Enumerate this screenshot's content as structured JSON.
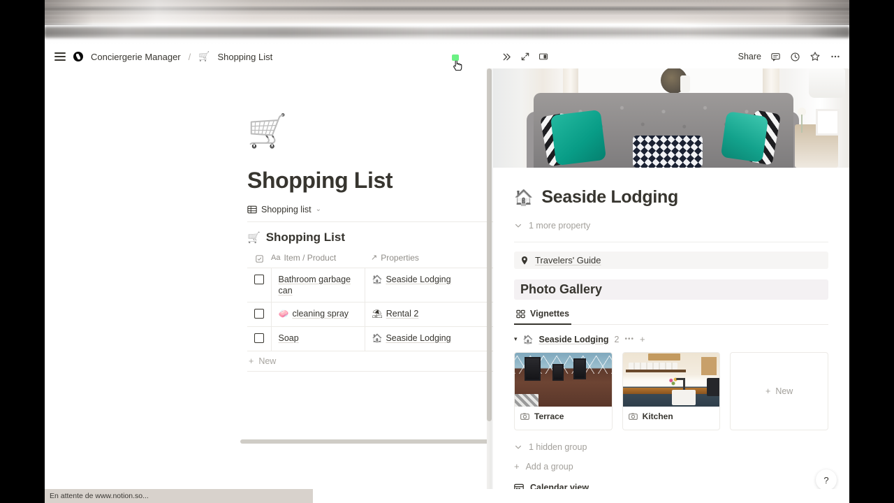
{
  "browser": {
    "status_text": "En attente de www.notion.so..."
  },
  "topbar": {
    "menu_icon": "hamburger-icon",
    "workspace_icon": "notion-logo-icon",
    "breadcrumb": [
      {
        "label": "Conciergerie Manager",
        "emoji": ""
      },
      {
        "label": "Shopping List",
        "emoji": "🛒"
      }
    ],
    "separator": "/"
  },
  "left_page": {
    "page_emoji": "🛒",
    "title": "Shopping List",
    "database_selector": {
      "label": "Shopping list",
      "chevron": "⌄",
      "icon": "table-icon"
    },
    "table": {
      "emoji": "🛒",
      "name": "Shopping List",
      "columns": [
        {
          "label": "",
          "icon": "checkbox-icon"
        },
        {
          "label": "Item / Product",
          "icon": "Aa"
        },
        {
          "label": "Properties",
          "icon": "↗"
        }
      ],
      "rows": [
        {
          "checked": false,
          "item": "Bathroom garbage can",
          "item_emoji": "",
          "property": "Seaside Lodging",
          "property_emoji": "🏠"
        },
        {
          "checked": false,
          "item": "cleaning spray",
          "item_emoji": "🧼",
          "property": "Rental 2",
          "property_emoji": "⛱"
        },
        {
          "checked": false,
          "item": "Soap",
          "item_emoji": "",
          "property": "Seaside Lodging",
          "property_emoji": "🏠"
        }
      ],
      "new_row_label": "New"
    }
  },
  "peek_panel": {
    "toolbar": {
      "close_icon": "double-chevron-right-icon",
      "expand_icon": "expand-diagonal-icon",
      "fullpage_icon": "side-peek-icon",
      "share_label": "Share",
      "comment_icon": "comment-icon",
      "history_icon": "clock-icon",
      "favorite_icon": "star-icon",
      "more_icon": "more-horizontal-icon"
    },
    "cover_alt": "grey tufted sofa with teal pillows",
    "scroll_up_icon": "chevron-up-icon",
    "title": "Seaside Lodging",
    "title_emoji": "🏠",
    "more_properties": "1 more property",
    "travelers_guide": {
      "label": "Travelers' Guide",
      "icon": "location-pin-icon"
    },
    "gallery": {
      "heading": "Photo Gallery",
      "tab": {
        "label": "Vignettes",
        "icon": "gallery-grid-icon"
      },
      "group": {
        "toggle": "▾",
        "emoji": "🏠",
        "name": "Seaside Lodging",
        "count": "2",
        "more": "•••",
        "add": "+"
      },
      "cards": [
        {
          "caption": "Terrace",
          "icon": "camera-icon",
          "thumb": "terrace"
        },
        {
          "caption": "Kitchen",
          "icon": "camera-icon",
          "thumb": "kitchen"
        }
      ],
      "new_card_label": "New",
      "hidden_group": "1 hidden group",
      "add_group": "Add a group"
    },
    "calendar_view": {
      "label": "Calendar view",
      "icon": "calendar-icon"
    }
  },
  "help": {
    "label": "?"
  }
}
